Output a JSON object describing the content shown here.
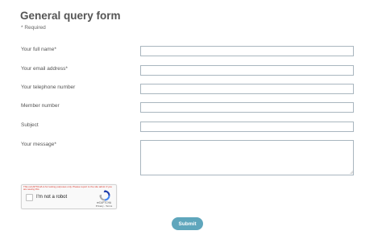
{
  "form": {
    "title": "General query form",
    "required_note": "* Required",
    "fields": [
      {
        "label": "Your full name*",
        "value": ""
      },
      {
        "label": "Your email address*",
        "value": ""
      },
      {
        "label": "Your telephone number",
        "value": ""
      },
      {
        "label": "Member number",
        "value": ""
      },
      {
        "label": "Subject",
        "value": ""
      },
      {
        "label": "Your message*",
        "value": ""
      }
    ]
  },
  "recaptcha": {
    "warning": "This reCAPTCHA is for testing purposes only. Please report to the site admin if you are seeing this.",
    "label": "I'm not a robot",
    "brand": "reCAPTCHA",
    "links": "Privacy - Terms",
    "checked": false
  },
  "submit_label": "Submit",
  "colors": {
    "accent": "#5fa6bc",
    "input_border": "#a9b6bf",
    "warning": "#d93025"
  },
  "icons": [
    "recaptcha-logo-icon",
    "resize-grip-icon"
  ]
}
